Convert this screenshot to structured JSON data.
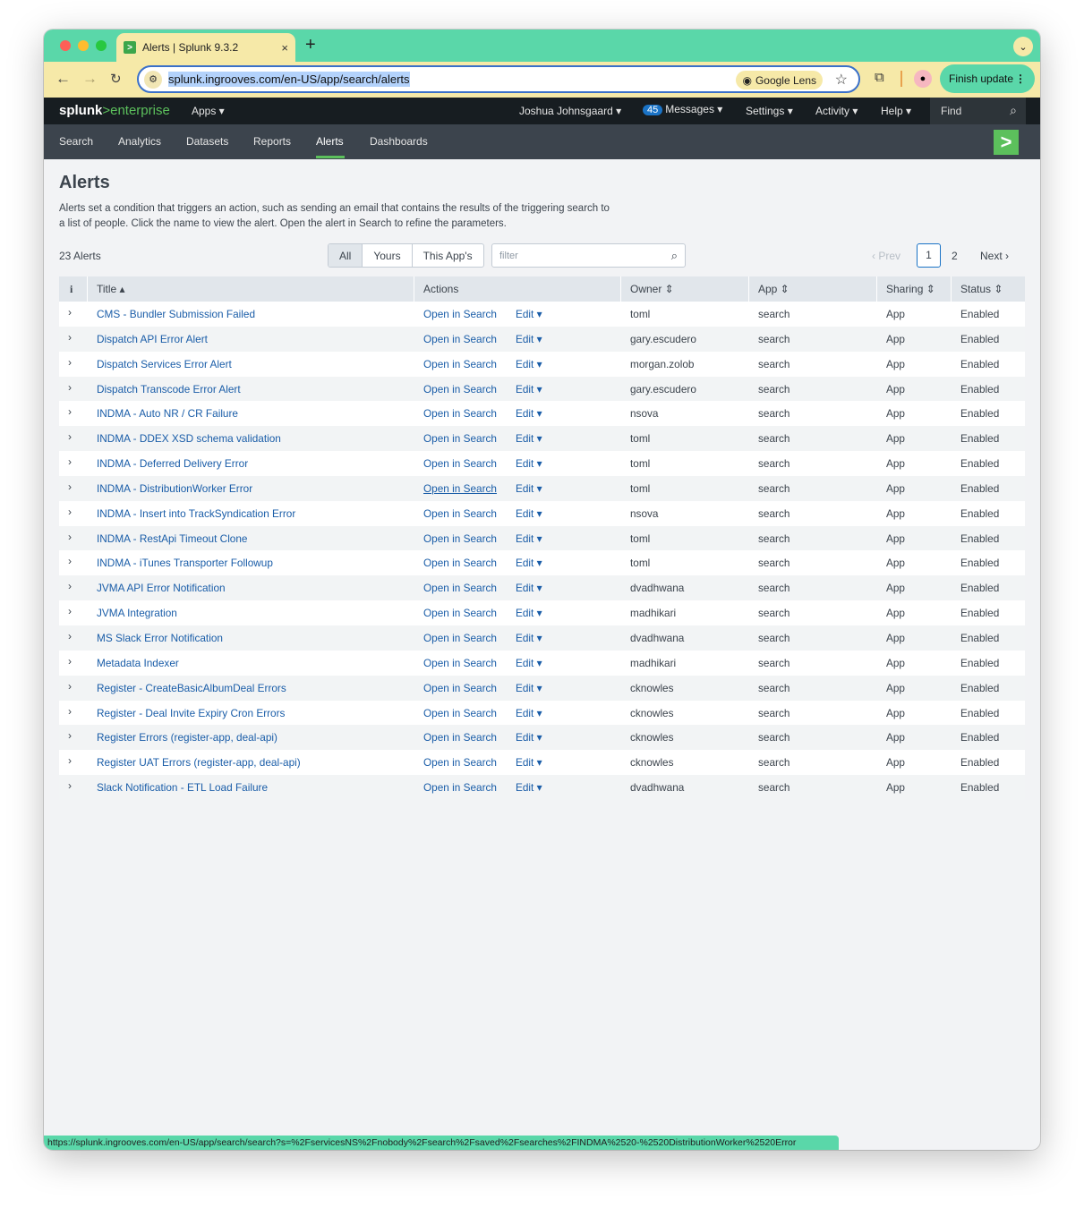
{
  "browser": {
    "tab_title": "Alerts | Splunk 9.3.2",
    "tab_close": "×",
    "new_tab": "+",
    "url": "splunk.ingrooves.com/en-US/app/search/alerts",
    "google_lens": "Google Lens",
    "finish_update": "Finish update",
    "status_url": "https://splunk.ingrooves.com/en-US/app/search/search?s=%2FservicesNS%2Fnobody%2Fsearch%2Fsaved%2Fsearches%2FINDMA%2520-%2520DistributionWorker%2520Error"
  },
  "splunkbar": {
    "logo_bold": "splunk",
    "logo_light": ">enterprise",
    "apps": "Apps ▾",
    "user": "Joshua Johnsgaard ▾",
    "messages_count": "45",
    "messages": "Messages ▾",
    "settings": "Settings ▾",
    "activity": "Activity ▾",
    "help": "Help ▾",
    "find": "Find"
  },
  "appnav": {
    "items": [
      "Search",
      "Analytics",
      "Datasets",
      "Reports",
      "Alerts",
      "Dashboards"
    ]
  },
  "page": {
    "title": "Alerts",
    "description": "Alerts set a condition that triggers an action, such as sending an email that contains the results of the triggering search to a list of people. Click the name to view the alert. Open the alert in Search to refine the parameters.",
    "count": "23 Alerts",
    "filter_tabs": [
      "All",
      "Yours",
      "This App's"
    ],
    "filter_placeholder": "filter",
    "pager": {
      "prev": "‹ Prev",
      "current": "1",
      "page2": "2",
      "next": "Next ›"
    }
  },
  "table": {
    "headers": {
      "info": "i",
      "title": "Title ▴",
      "actions": "Actions",
      "owner": "Owner ⇕",
      "app": "App ⇕",
      "sharing": "Sharing ⇕",
      "status": "Status ⇕"
    },
    "open_label": "Open in Search",
    "edit_label": "Edit ▾",
    "rows": [
      {
        "title": "CMS - Bundler Submission Failed",
        "owner": "toml",
        "app": "search",
        "sharing": "App",
        "status": "Enabled"
      },
      {
        "title": "Dispatch API Error Alert",
        "owner": "gary.escudero",
        "app": "search",
        "sharing": "App",
        "status": "Enabled"
      },
      {
        "title": "Dispatch Services Error Alert",
        "owner": "morgan.zolob",
        "app": "search",
        "sharing": "App",
        "status": "Enabled"
      },
      {
        "title": "Dispatch Transcode Error Alert",
        "owner": "gary.escudero",
        "app": "search",
        "sharing": "App",
        "status": "Enabled"
      },
      {
        "title": "INDMA - Auto NR / CR Failure",
        "owner": "nsova",
        "app": "search",
        "sharing": "App",
        "status": "Enabled"
      },
      {
        "title": "INDMA - DDEX XSD schema validation",
        "owner": "toml",
        "app": "search",
        "sharing": "App",
        "status": "Enabled"
      },
      {
        "title": "INDMA - Deferred Delivery Error",
        "owner": "toml",
        "app": "search",
        "sharing": "App",
        "status": "Enabled"
      },
      {
        "title": "INDMA - DistributionWorker Error",
        "owner": "toml",
        "app": "search",
        "sharing": "App",
        "status": "Enabled"
      },
      {
        "title": "INDMA - Insert into TrackSyndication Error",
        "owner": "nsova",
        "app": "search",
        "sharing": "App",
        "status": "Enabled"
      },
      {
        "title": "INDMA - RestApi Timeout Clone",
        "owner": "toml",
        "app": "search",
        "sharing": "App",
        "status": "Enabled"
      },
      {
        "title": "INDMA - iTunes Transporter Followup",
        "owner": "toml",
        "app": "search",
        "sharing": "App",
        "status": "Enabled"
      },
      {
        "title": "JVMA API Error Notification",
        "owner": "dvadhwana",
        "app": "search",
        "sharing": "App",
        "status": "Enabled"
      },
      {
        "title": "JVMA Integration",
        "owner": "madhikari",
        "app": "search",
        "sharing": "App",
        "status": "Enabled"
      },
      {
        "title": "MS Slack Error Notification",
        "owner": "dvadhwana",
        "app": "search",
        "sharing": "App",
        "status": "Enabled"
      },
      {
        "title": "Metadata Indexer",
        "owner": "madhikari",
        "app": "search",
        "sharing": "App",
        "status": "Enabled"
      },
      {
        "title": "Register - CreateBasicAlbumDeal Errors",
        "owner": "cknowles",
        "app": "search",
        "sharing": "App",
        "status": "Enabled"
      },
      {
        "title": "Register - Deal Invite Expiry Cron Errors",
        "owner": "cknowles",
        "app": "search",
        "sharing": "App",
        "status": "Enabled"
      },
      {
        "title": "Register Errors (register-app, deal-api)",
        "owner": "cknowles",
        "app": "search",
        "sharing": "App",
        "status": "Enabled"
      },
      {
        "title": "Register UAT Errors (register-app, deal-api)",
        "owner": "cknowles",
        "app": "search",
        "sharing": "App",
        "status": "Enabled"
      },
      {
        "title": "Slack Notification - ETL Load Failure",
        "owner": "dvadhwana",
        "app": "search",
        "sharing": "App",
        "status": "Enabled"
      }
    ]
  },
  "colors": {
    "accent": "#5ad7a9",
    "link": "#1a5da8",
    "splunk_green": "#5cc05c"
  }
}
